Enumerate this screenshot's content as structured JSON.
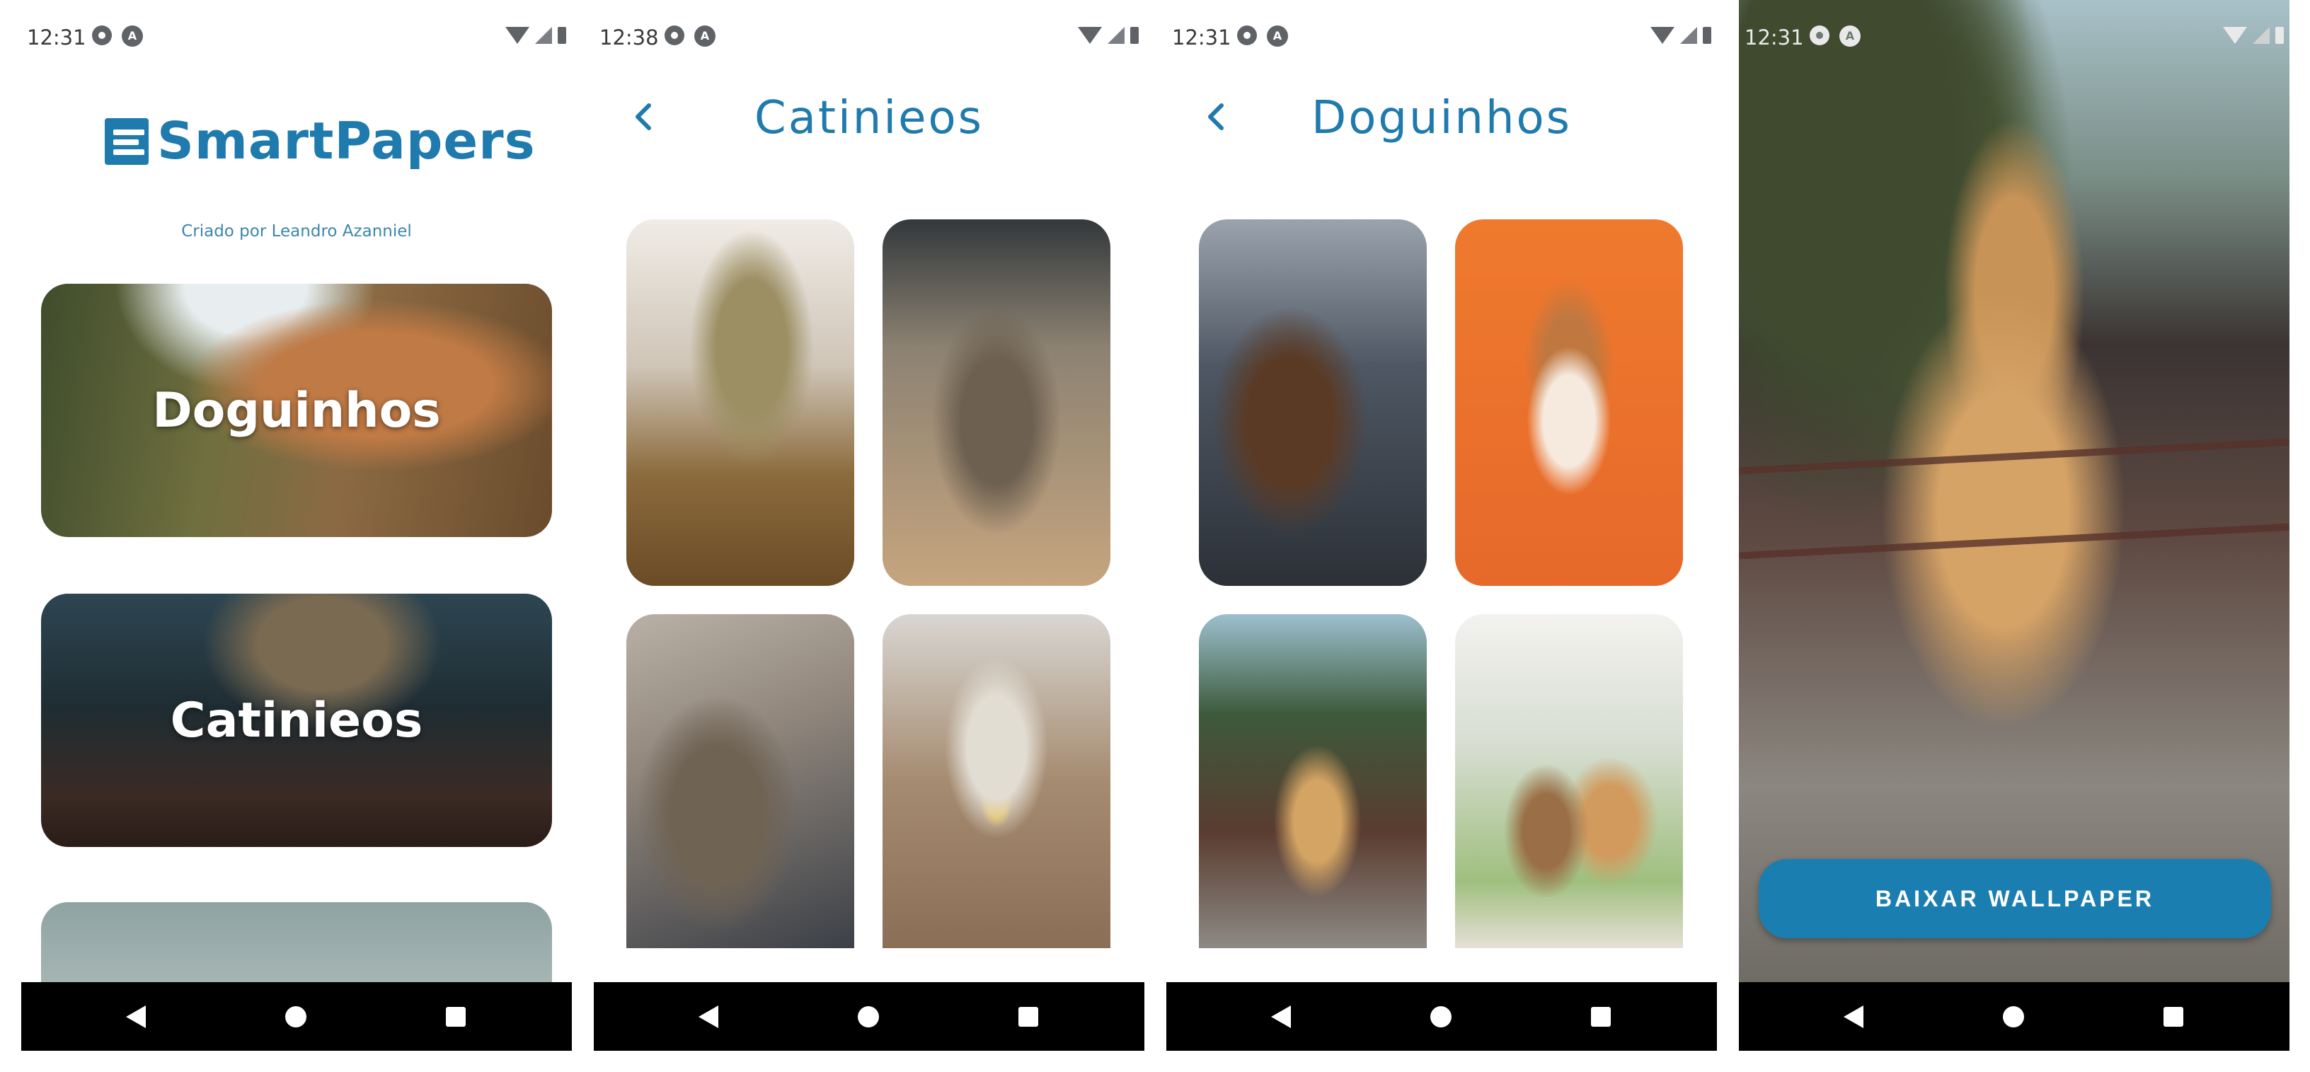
{
  "screens": {
    "home": {
      "status_time": "12:31",
      "logo_text": "SmartPapers",
      "credit": "Criado por Leandro Azanniel",
      "categories": [
        {
          "label": "Doguinhos"
        },
        {
          "label": "Catinieos"
        },
        {
          "label": ""
        }
      ]
    },
    "cats": {
      "status_time": "12:38",
      "title": "Catinieos",
      "thumbnails": [
        "cat-photo-1",
        "cat-photo-2",
        "cat-photo-3",
        "cat-photo-4"
      ]
    },
    "dogs": {
      "status_time": "12:31",
      "title": "Doguinhos",
      "thumbnails": [
        "dog-photo-1",
        "dog-photo-2",
        "dog-photo-3",
        "dog-photo-4"
      ]
    },
    "wallpaper": {
      "status_time": "12:31",
      "download_button": "BAIXAR WALLPAPER"
    }
  },
  "colors": {
    "brand": "#1f7aad",
    "button": "#1b7eb0",
    "navbar": "#000000"
  },
  "icons": {
    "status": [
      "gear-icon",
      "a-circle-icon",
      "wifi-icon",
      "cell-signal-icon",
      "battery-icon"
    ],
    "nav": [
      "nav-back-icon",
      "nav-home-icon",
      "nav-recents-icon"
    ],
    "back": "chevron-left-icon"
  }
}
